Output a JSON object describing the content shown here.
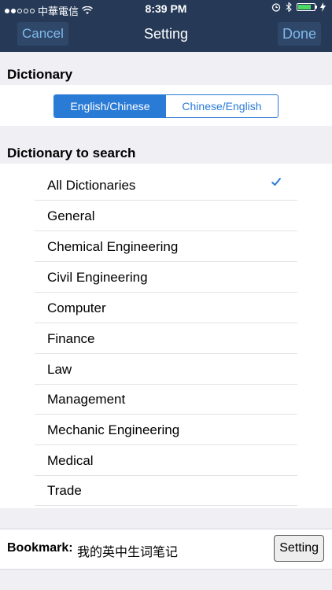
{
  "status_bar": {
    "carrier": "中華電信",
    "time": "8:39 PM",
    "icons": [
      "signal-dots-icon",
      "wifi-icon",
      "alarm-icon",
      "bluetooth-icon",
      "battery-icon",
      "charging-icon"
    ],
    "battery_level": 0.8
  },
  "navbar": {
    "cancel_label": "Cancel",
    "title": "Setting",
    "done_label": "Done"
  },
  "dictionary": {
    "header": "Dictionary",
    "options": [
      "English/Chinese",
      "Chinese/English"
    ],
    "selected": "English/Chinese"
  },
  "search": {
    "header": "Dictionary to search",
    "items": [
      {
        "label": "All Dictionaries",
        "checked": true
      },
      {
        "label": "General",
        "checked": false
      },
      {
        "label": "Chemical Engineering",
        "checked": false
      },
      {
        "label": "Civil Engineering",
        "checked": false
      },
      {
        "label": "Computer",
        "checked": false
      },
      {
        "label": "Finance",
        "checked": false
      },
      {
        "label": "Law",
        "checked": false
      },
      {
        "label": "Management",
        "checked": false
      },
      {
        "label": "Mechanic Engineering",
        "checked": false
      },
      {
        "label": "Medical",
        "checked": false
      },
      {
        "label": "Trade",
        "checked": false
      }
    ]
  },
  "bookmark": {
    "label": "Bookmark:",
    "value": "我的英中生词笔记",
    "button_label": "Setting"
  },
  "colors": {
    "navbar_bg": "#263a58",
    "accent": "#2a7bd6",
    "nav_button_text": "#7fb9ec"
  }
}
